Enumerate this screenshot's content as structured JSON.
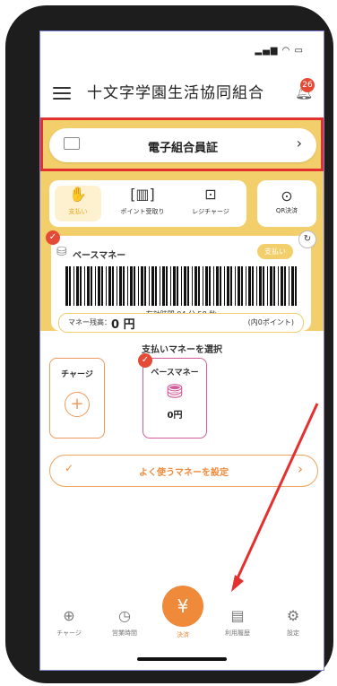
{
  "status": {
    "signal": " .              "
  },
  "header": {
    "title": "十文字学園生活協同組合",
    "badge_count": "26"
  },
  "member_card": {
    "label": "電子組合員証"
  },
  "tabs": [
    {
      "label": "支払い",
      "icon": "coin-hand-icon"
    },
    {
      "label": "ポイント受取り",
      "icon": "scan-icon"
    },
    {
      "label": "レジチャージ",
      "icon": "register-icon"
    }
  ],
  "qr_tab": {
    "label": "QR決済",
    "icon": "camera-icon"
  },
  "money_card": {
    "title": "ベースマネー",
    "pay_pill": "支払い",
    "expiry": "有効時間 04 分 58 秒",
    "balance_label": "マネー残高：",
    "balance_value": "0 円",
    "points": "(内0ポイント)"
  },
  "select": {
    "title": "支払いマネーを選択",
    "charge_label": "チャージ",
    "base_label": "ベースマネー",
    "base_value": "0円"
  },
  "favorite": {
    "label": "よく使うマネーを設定"
  },
  "nav": {
    "items": [
      {
        "label": "チャージ",
        "icon": "plus-circle-icon"
      },
      {
        "label": "営業時間",
        "icon": "clock-icon"
      },
      {
        "label": "決済",
        "icon": "yen-icon"
      },
      {
        "label": "利用履歴",
        "icon": "history-icon"
      },
      {
        "label": "設定",
        "icon": "gear-icon"
      }
    ]
  },
  "colors": {
    "accent": "#f08a3b",
    "yellow": "#f3cf6b",
    "highlight": "#e3312f"
  }
}
